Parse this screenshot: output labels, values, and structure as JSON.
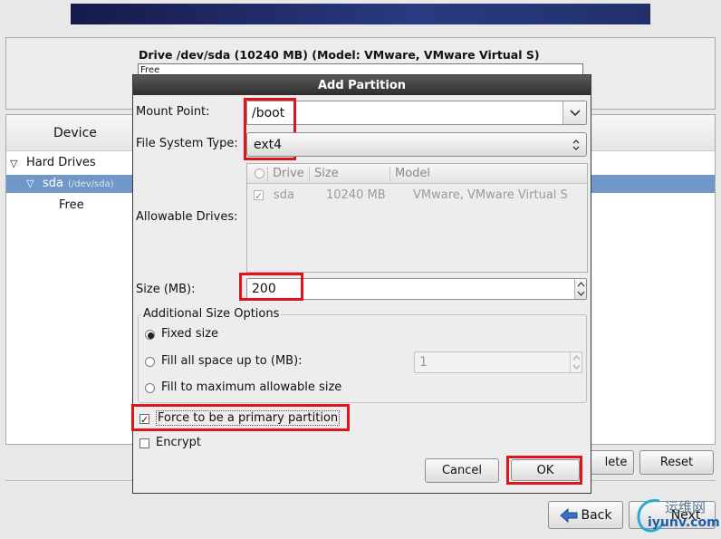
{
  "drive_info": {
    "title": "Drive /dev/sda (10240 MB) (Model: VMware, VMware Virtual S)",
    "map_label": "Free"
  },
  "tree": {
    "header": "Device",
    "hard_drives": "Hard Drives",
    "sda": "sda",
    "sda_path": "(/dev/sda)",
    "free": "Free"
  },
  "bottom_buttons": {
    "delete_partial": "lete",
    "reset": "Reset",
    "back": "Back",
    "next": "Next"
  },
  "watermark": {
    "line1": "运维网",
    "line2": "iyunv.com"
  },
  "dialog": {
    "title": "Add Partition",
    "mount_point_label": "Mount Point:",
    "mount_point_value": "/boot",
    "fs_type_label": "File System Type:",
    "fs_type_value": "ext4",
    "allowable_drives_label": "Allowable Drives:",
    "drives_columns": [
      "Drive",
      "Size",
      "Model"
    ],
    "drives_rows": [
      {
        "checked": true,
        "drive": "sda",
        "size": "10240 MB",
        "model": "VMware, VMware Virtual S"
      }
    ],
    "size_label": "Size (MB):",
    "size_value": "200",
    "additional_size_options": "Additional Size Options",
    "fixed_size": "Fixed size",
    "fill_up_to": "Fill all space up to (MB):",
    "fill_up_to_value": "1",
    "fill_max": "Fill to maximum allowable size",
    "force_primary": "Force to be a primary partition",
    "encrypt": "Encrypt",
    "cancel": "Cancel",
    "ok": "OK"
  },
  "colors": {
    "highlight": "#e0141b",
    "selection": "#6f98c9",
    "titlebar": "#3a3a3a"
  }
}
